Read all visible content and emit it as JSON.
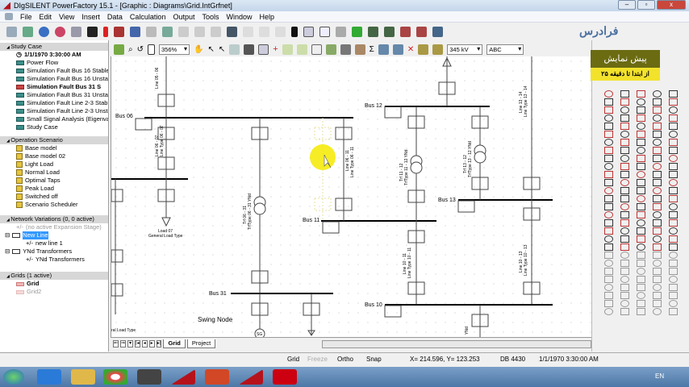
{
  "window": {
    "title": "DIgSILENT PowerFactory 15.1 - [Graphic : Diagrams\\Grid.IntGrfnet]",
    "min": "–",
    "max": "▫",
    "close": "x"
  },
  "menu": [
    "File",
    "Edit",
    "View",
    "Insert",
    "Data",
    "Calculation",
    "Output",
    "Tools",
    "Window",
    "Help"
  ],
  "left": {
    "study_case": {
      "header": "Study Case",
      "items": [
        "1/1/1970 3:30:00 AM",
        "Power Flow",
        "Simulation Fault Bus 16 Stable",
        "Simulation Fault Bus 16 Unstab",
        "Simulation Fault Bus 31 S",
        "Simulation Fault Bus 31 Unstab",
        "Simulation Fault Line 2-3 Stable",
        "Simulation Fault Line 2-3 Unsta",
        "Small Signal Analysis (Eigenval",
        "Study Case"
      ]
    },
    "operation": {
      "header": "Operation Scenario",
      "items": [
        "Base model",
        "Base model 02",
        "Light Load",
        "Normal Load",
        "Optimal Taps",
        "Peak Load",
        "Switched off",
        "Scenario Scheduler"
      ]
    },
    "variations": {
      "header": "Network Variations (0, 0 active)",
      "items": [
        "(no active Expansion Stage)",
        "New Line",
        "new line 1",
        "YNd Transformers",
        "YNd Transformers"
      ],
      "prefix": "+/-"
    },
    "grids": {
      "header": "Grids (1 active)",
      "items": [
        "Grid",
        "Grid2"
      ]
    }
  },
  "drawing_toolbar": {
    "zoom": "356%",
    "voltage": "345 kV",
    "text_style": "ABC"
  },
  "diagram": {
    "buses": [
      "Bus 06",
      "Bus 12",
      "Bus 13",
      "Bus 11",
      "Bus 31",
      "Bus 10"
    ],
    "labels": {
      "line0506": "Line 05 - 06",
      "line0607": "Line 06 - 07",
      "type0607": "Line Type 06 - 07",
      "line0611": "Line 06 - 11",
      "type0611": "Line Type 06 - 11",
      "trf0631": "Trf 06 - 31",
      "trftype0631": "TrfType 06 - 31 YNd",
      "trf1112": "Trf 11 - 12",
      "trftype1112": "TrfType 11 - 12 YNd",
      "trf1312": "Trf 13 - 12",
      "trftype1312": "TrfType 13 - 12 YNd",
      "line1314": "Line 13 - 14",
      "type1314": "Line Type 13 - 14",
      "line1011": "Line 10 - 11",
      "type1011": "Line Type 10 - 11",
      "line1013": "Line 10 - 13",
      "type1013": "Line Type 10 - 13",
      "load07": "Load 07",
      "loadtype": "General Load Type",
      "loadleft": "ral Load Type",
      "swing": "Swing Node",
      "sg": "SG",
      "ynd": "YNd"
    }
  },
  "tabs": [
    "Grid",
    "Project"
  ],
  "status": {
    "grid": "Grid",
    "freeze": "Freeze",
    "ortho": "Ortho",
    "snap": "Snap",
    "coords": "X=   214.596, Y=   123.253",
    "db": "DB 4430",
    "datetime": "1/1/1970 3:30:00 AM"
  },
  "banner": {
    "title": "پیش نمایش",
    "subtitle": "از ابتدا تا دقیقه ۲۵",
    "logo": "فرادرس"
  },
  "taskbar": {
    "lang": "EN"
  },
  "colors": {
    "accent": "#3399ff",
    "banner": "#6b6b12",
    "banner_sub": "#f2e22c"
  }
}
